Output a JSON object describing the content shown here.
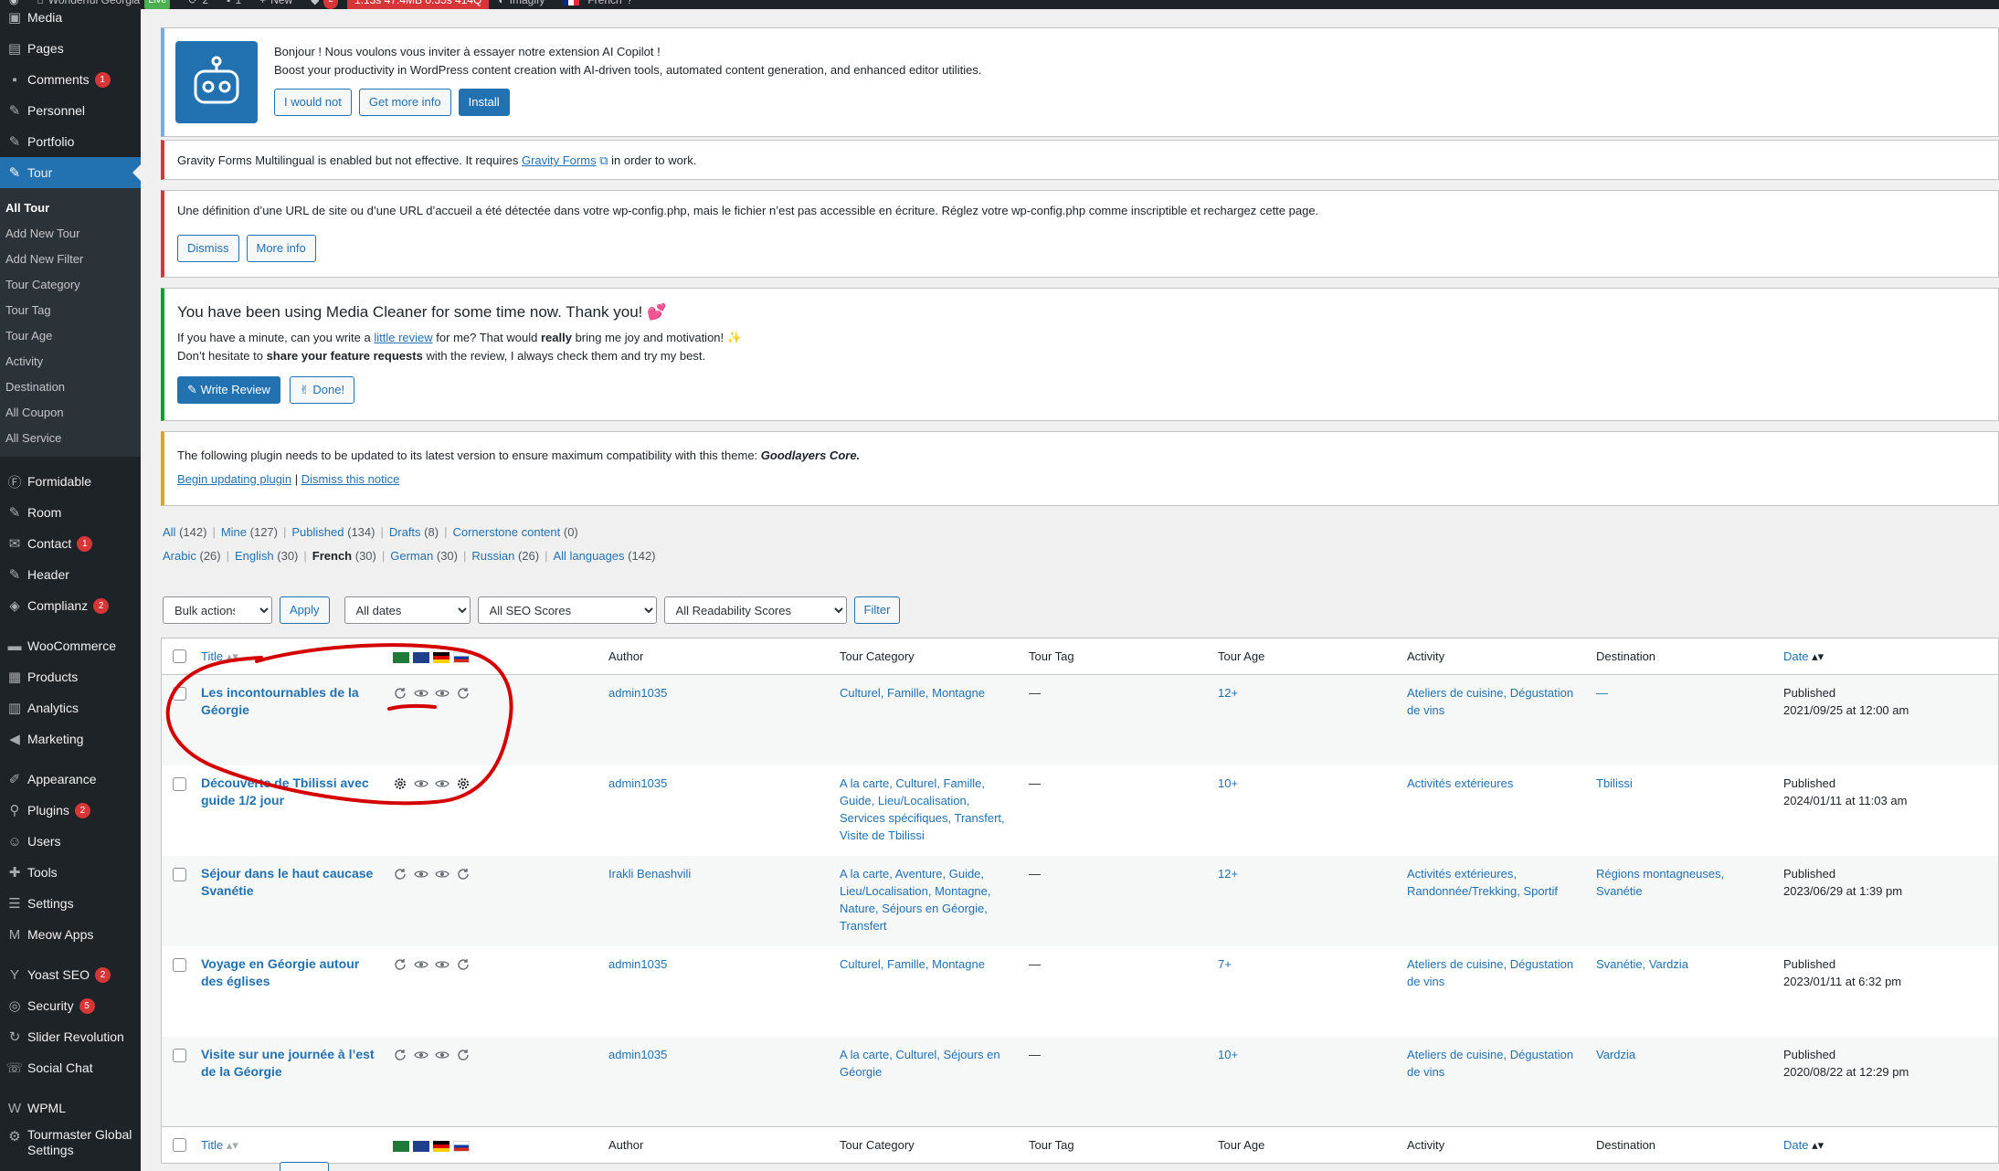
{
  "adminbar": {
    "site_name": "Wonderful Georgia",
    "live_label": "Live",
    "updates_count": "2",
    "comments_count": "1",
    "new_label": "New",
    "notif_count": "2",
    "qm_stats": "1.13s  47.4MB  0.35s  414Q",
    "imagify_label": "Imagify",
    "language_label": "French"
  },
  "sidebar": {
    "items": [
      {
        "label": "Media",
        "icon": "media-icon"
      },
      {
        "label": "Pages",
        "icon": "pages-icon"
      },
      {
        "label": "Comments",
        "icon": "comments-icon",
        "badge": "1"
      },
      {
        "label": "Personnel",
        "icon": "pin-icon"
      },
      {
        "label": "Portfolio",
        "icon": "pin-icon"
      },
      {
        "label": "Tour",
        "icon": "pin-icon"
      }
    ],
    "submenu": [
      "All Tour",
      "Add New Tour",
      "Add New Filter",
      "Tour Category",
      "Tour Tag",
      "Tour Age",
      "Activity",
      "Destination",
      "All Coupon",
      "All Service"
    ],
    "items2": [
      {
        "label": "Formidable",
        "icon": "formidable-icon"
      },
      {
        "label": "Room",
        "icon": "pin-icon"
      },
      {
        "label": "Contact",
        "icon": "mail-icon",
        "badge": "1"
      },
      {
        "label": "Header",
        "icon": "pin-icon"
      },
      {
        "label": "Complianz",
        "icon": "shield-icon",
        "badge": "2"
      }
    ],
    "items3": [
      {
        "label": "WooCommerce",
        "icon": "woo-icon"
      },
      {
        "label": "Products",
        "icon": "products-icon"
      },
      {
        "label": "Analytics",
        "icon": "analytics-icon"
      },
      {
        "label": "Marketing",
        "icon": "megaphone-icon"
      }
    ],
    "items4": [
      {
        "label": "Appearance",
        "icon": "brush-icon"
      },
      {
        "label": "Plugins",
        "icon": "plugins-icon",
        "badge": "2"
      },
      {
        "label": "Users",
        "icon": "users-icon"
      },
      {
        "label": "Tools",
        "icon": "tools-icon"
      },
      {
        "label": "Settings",
        "icon": "settings-icon"
      },
      {
        "label": "Meow Apps",
        "icon": "meow-icon"
      }
    ],
    "items5": [
      {
        "label": "Yoast SEO",
        "icon": "yoast-icon",
        "badge": "2"
      },
      {
        "label": "Security",
        "icon": "security-icon",
        "badge": "5"
      },
      {
        "label": "Slider Revolution",
        "icon": "slider-icon"
      },
      {
        "label": "Social Chat",
        "icon": "chat-icon"
      }
    ],
    "items6": [
      {
        "label": "WPML",
        "icon": "wpml-icon"
      },
      {
        "label": "Tourmaster Global Settings",
        "icon": "gear-icon"
      }
    ]
  },
  "notices": {
    "copilot": {
      "line1": "Bonjour ! Nous voulons vous inviter à essayer notre extension AI Copilot !",
      "line2": "Boost your productivity in WordPress content creation with AI-driven tools, automated content generation, and enhanced editor utilities.",
      "btn_no": "I would not",
      "btn_more": "Get more info",
      "btn_install": "Install"
    },
    "gravity": {
      "before": "Gravity Forms Multilingual is enabled but not effective. It requires",
      "link": "Gravity Forms",
      "after": "in order to work."
    },
    "url": {
      "text": "Une définition d’une URL de site ou d’une URL d’accueil a été détectée dans votre wp-config.php, mais le fichier n’est pas accessible en écriture. Réglez votre wp-config.php comme inscriptible et rechargez cette page.",
      "btn_dismiss": "Dismiss",
      "btn_more": "More info"
    },
    "cleaner": {
      "title": "You have been using Media Cleaner for some time now. Thank you!",
      "p1_a": "If you have a minute, can you write a",
      "p1_link": "little review",
      "p1_b": "for me? That would",
      "p1_bold": "really",
      "p1_c": "bring me joy and motivation!",
      "p2_a": "Don’t hesitate to",
      "p2_bold": "share your feature requests",
      "p2_b": "with the review, I always check them and try my best.",
      "btn_review": "Write Review",
      "btn_done": "Done!"
    },
    "plugin": {
      "text": "The following plugin needs to be updated to its latest version to ensure maximum compatibility with this theme:",
      "plugin_name": "Goodlayers Core.",
      "link_update": "Begin updating plugin",
      "divider": "|",
      "link_dismiss": "Dismiss this notice"
    }
  },
  "status_filters": [
    {
      "label": "All",
      "count": "(142)"
    },
    {
      "label": "Mine",
      "count": "(127)"
    },
    {
      "label": "Published",
      "count": "(134)"
    },
    {
      "label": "Drafts",
      "count": "(8)"
    },
    {
      "label": "Cornerstone content",
      "count": "(0)"
    }
  ],
  "language_filters": [
    {
      "label": "Arabic",
      "count": "(26)"
    },
    {
      "label": "English",
      "count": "(30)"
    },
    {
      "label": "French",
      "count": "(30)",
      "current": true
    },
    {
      "label": "German",
      "count": "(30)"
    },
    {
      "label": "Russian",
      "count": "(26)"
    },
    {
      "label": "All languages",
      "count": "(142)"
    }
  ],
  "toolbar": {
    "bulk_actions": "Bulk actions",
    "apply": "Apply",
    "dates": "All dates",
    "seo": "All SEO Scores",
    "readability": "All Readability Scores",
    "filter": "Filter"
  },
  "columns": {
    "title": "Title",
    "author": "Author",
    "category": "Tour Category",
    "tag": "Tour Tag",
    "age": "Tour Age",
    "activity": "Activity",
    "destination": "Destination",
    "date": "Date"
  },
  "rows": [
    {
      "title": "Les incontournables de la Géorgie",
      "author": "admin1035",
      "category": "Culturel, Famille, Montagne",
      "tag": "—",
      "age": "12+",
      "activity": "Ateliers de cuisine, Dégustation de vins",
      "destination": "—",
      "status": "Published",
      "date": "2021/09/25 at 12:00 am"
    },
    {
      "title": "Découverte de Tbilissi avec guide 1/2 jour",
      "author": "admin1035",
      "category": "A la carte, Culturel, Famille, Guide, Lieu/Localisation, Services spécifiques, Transfert, Visite de Tbilissi",
      "tag": "—",
      "age": "10+",
      "activity": "Activités extérieures",
      "destination": "Tbilissi",
      "status": "Published",
      "date": "2024/01/11 at 11:03 am"
    },
    {
      "title": "Séjour dans le haut caucase Svanétie",
      "author": "Irakli Benashvili",
      "category": "A la carte, Aventure, Guide, Lieu/Localisation, Montagne, Nature, Séjours en Géorgie, Transfert",
      "tag": "—",
      "age": "12+",
      "activity": "Activités extérieures, Randonnée/Trekking, Sportif",
      "destination": "Régions montagneuses, Svanétie",
      "status": "Published",
      "date": "2023/06/29 at 1:39 pm"
    },
    {
      "title": "Voyage en Géorgie autour des églises",
      "author": "admin1035",
      "category": "Culturel, Famille, Montagne",
      "tag": "—",
      "age": "7+",
      "activity": "Ateliers de cuisine, Dégustation de vins",
      "destination": "Svanétie, Vardzia",
      "status": "Published",
      "date": "2023/01/11 at 6:32 pm"
    },
    {
      "title": "Visite sur une journée à l’est de la Géorgie",
      "author": "admin1035",
      "category": "A la carte, Culturel, Séjours en Géorgie",
      "tag": "—",
      "age": "10+",
      "activity": "Ateliers de cuisine, Dégustation de vins",
      "destination": "Vardzia",
      "status": "Published",
      "date": "2020/08/22 at 12:29 pm"
    }
  ],
  "colors": {
    "sidebar_bg": "#1d2327",
    "accent": "#2271b1",
    "annotation_red": "#d40000"
  }
}
